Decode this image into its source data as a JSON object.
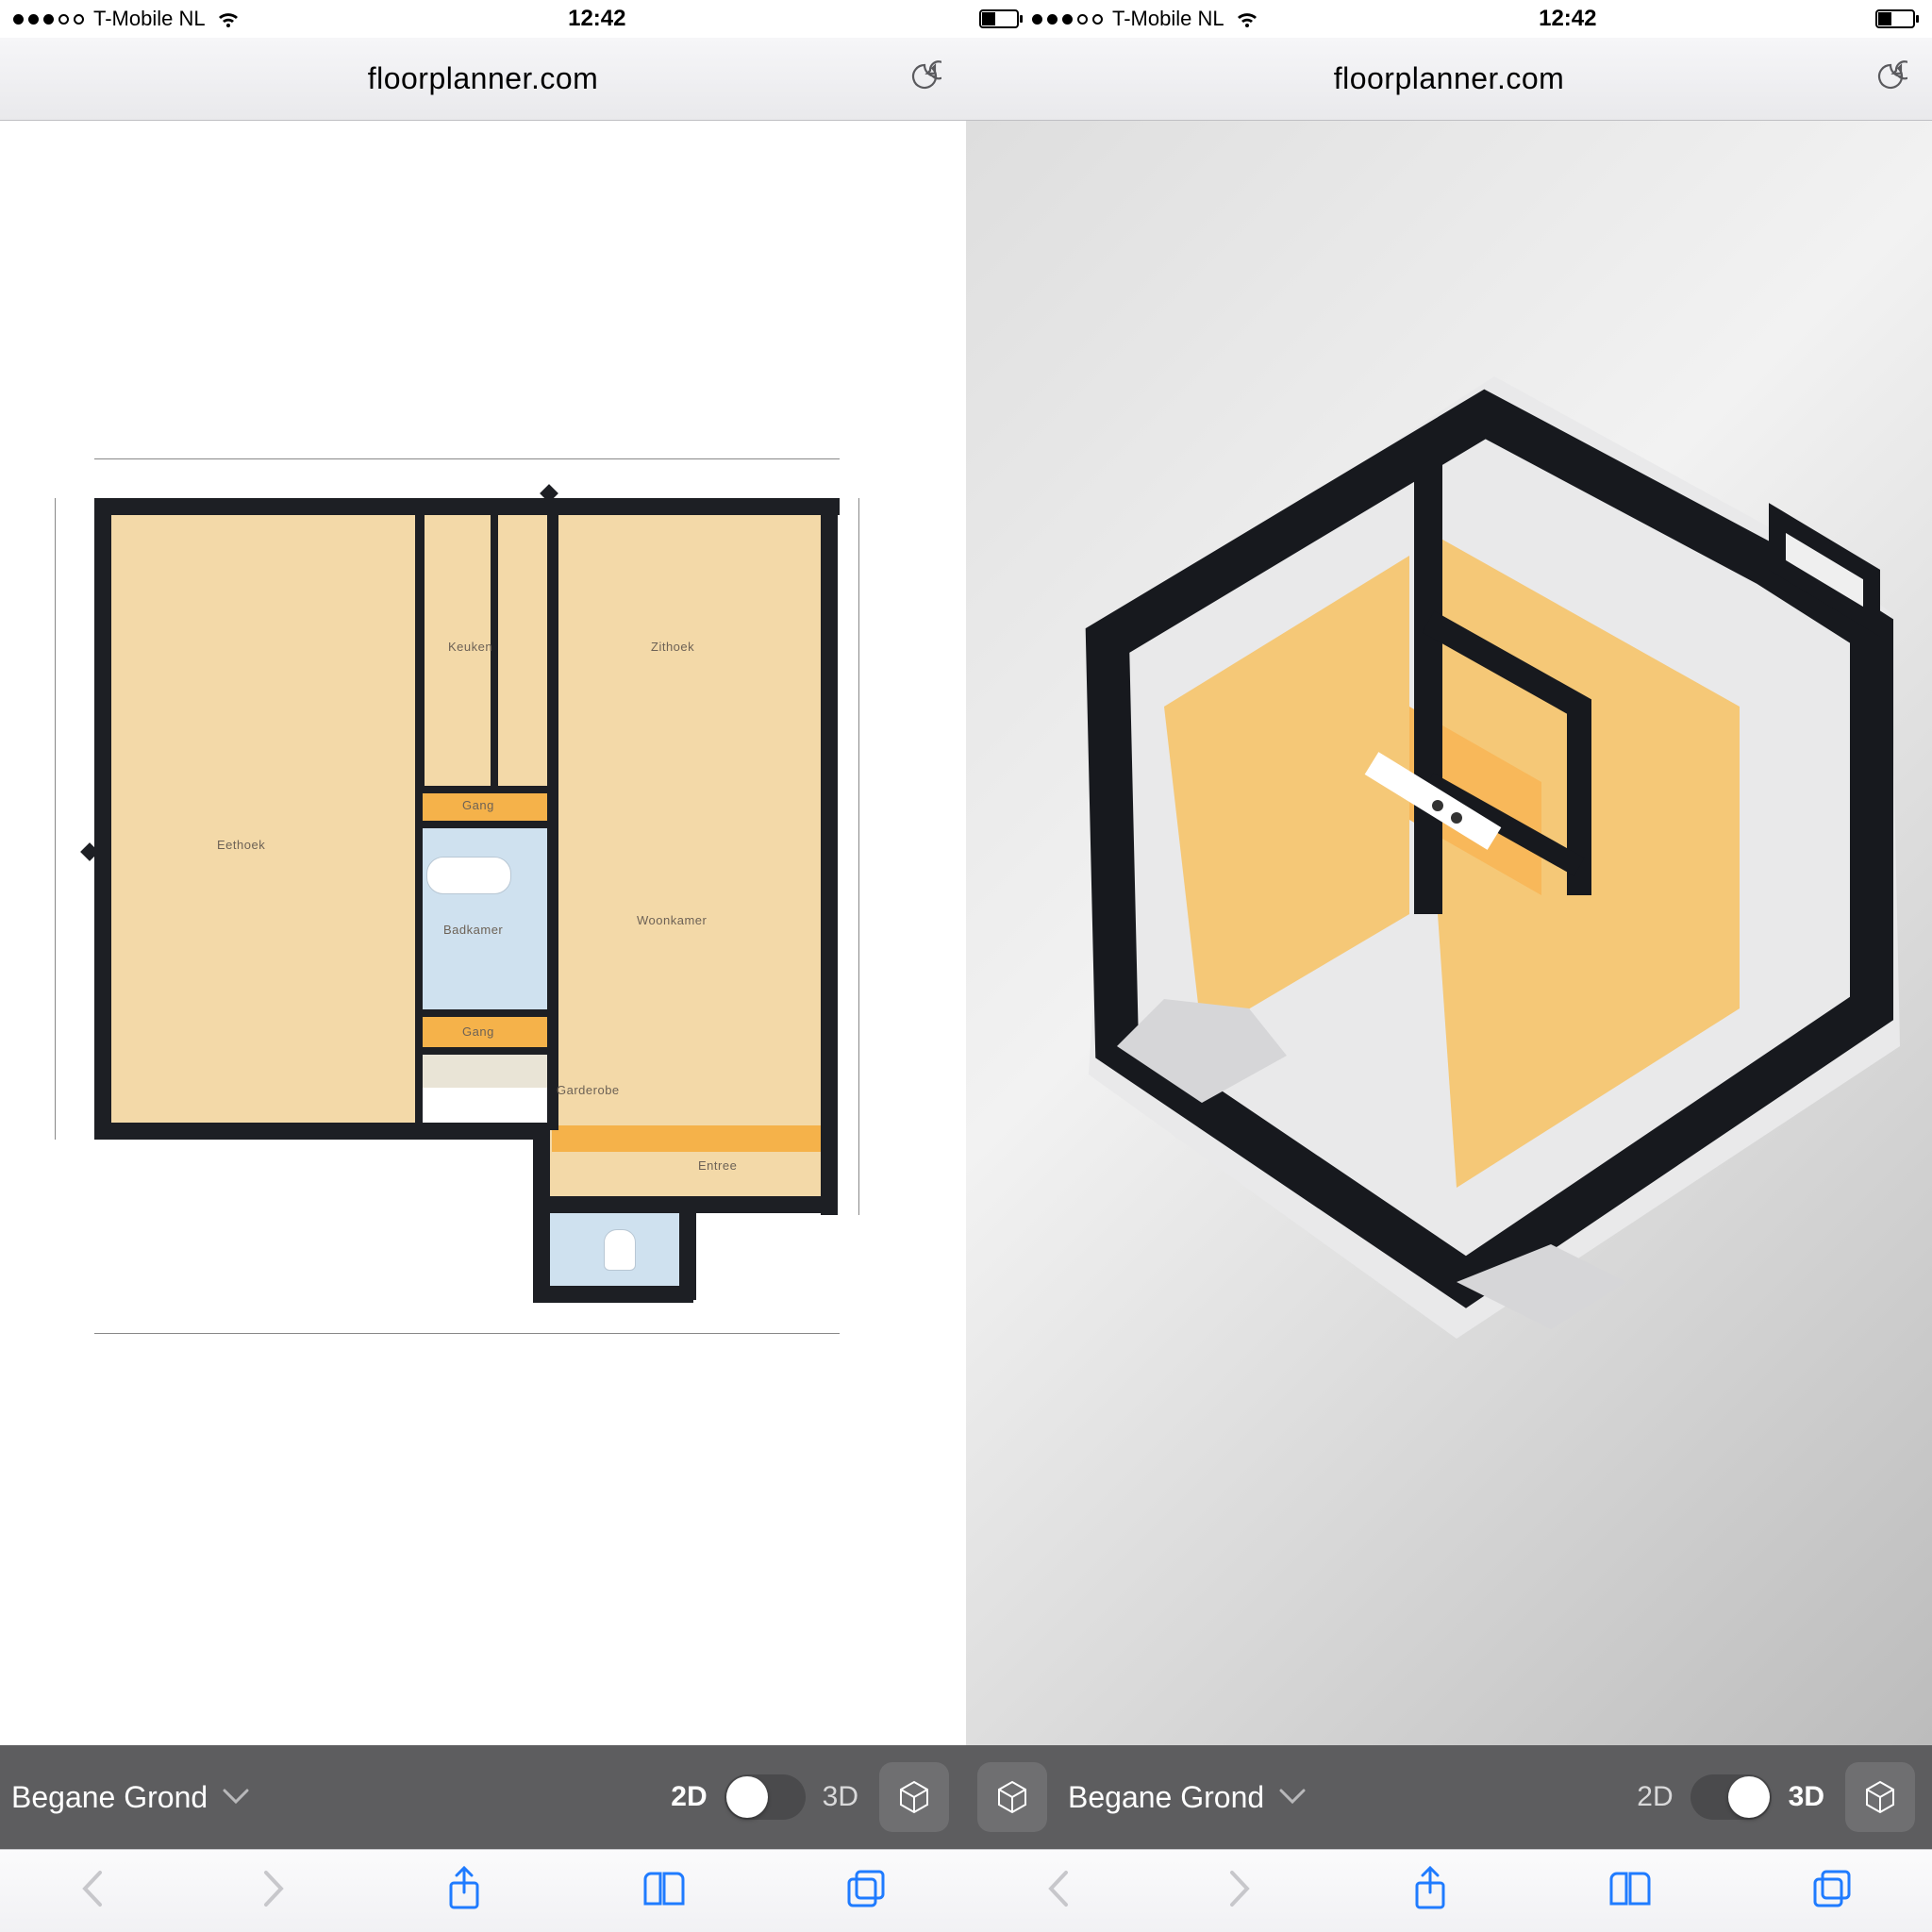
{
  "status": {
    "carrier": "T-Mobile NL",
    "time": "12:42"
  },
  "browser": {
    "url": "floorplanner.com"
  },
  "toolbar": {
    "floor_name": "Begane Grond",
    "mode_2d": "2D",
    "mode_3d": "3D"
  },
  "left": {
    "active_mode": "2D",
    "rooms": {
      "eethoek": "Eethoek",
      "keuken": "Keuken",
      "zithoek": "Zithoek",
      "gang1": "Gang",
      "gang2": "Gang",
      "badkamer": "Badkamer",
      "woonkamer": "Woonkamer",
      "garderobe": "Garderobe",
      "entree": "Entree"
    }
  },
  "right": {
    "active_mode": "3D"
  }
}
